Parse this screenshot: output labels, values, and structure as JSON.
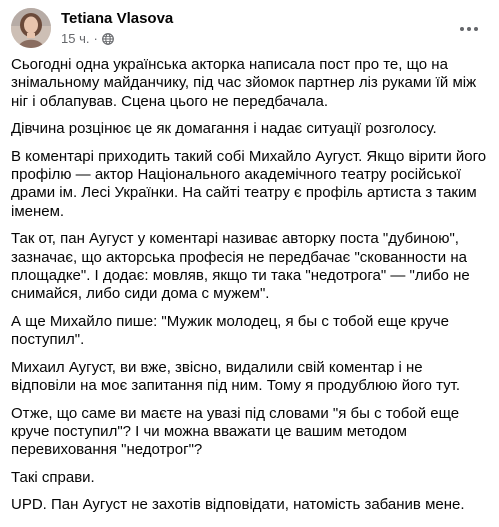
{
  "author": {
    "name": "Tetiana Vlasova",
    "time": "15 ч.",
    "separator": "·",
    "privacy_icon": "globe-icon",
    "avatar_icon": "profile-photo"
  },
  "menu": {
    "icon": "more-horizontal-icon"
  },
  "post": {
    "paragraphs": [
      "Сьогодні одна українська акторка написала пост про те, що на знімальному майданчику, під час зйомок партнер ліз руками їй між ніг і облапував. Сцена цього не передбачала.",
      "Дівчина розцінює це як домагання і надає ситуації розголосу.",
      "В коментарі приходить такий собі Михайло Аугуст. Якщо вірити його профілю — актор Національного академічного театру російської драми ім. Лесі Українки. На сайті театру є профіль артиста з таким іменем.",
      "Так от, пан Аугуст у коментарі називає авторку поста \"дубиною\", зазначає, що акторська професія не передбачає \"скованности на площадке\". І додає: мовляв, якщо ти така \"недотрога\" — \"либо не снимайся, либо сиди дома с мужем\".",
      "А ще Михайло пише: \"Мужик молодец, я бы с тобой еще круче поступил\".",
      "Михаил Аугуст, ви вже, звісно, видалили свій коментар і не відповіли на моє запитання під ним. Тому я продублюю його тут.",
      "Отже, що саме ви маєте на увазі під словами \"я бы с тобой еще круче поступил\"? І чи можна вважати це вашим методом перевиховання \"недотрог\"?",
      "Такі справи.",
      "UPD. Пан Аугуст не захотів відповідати, натомість забанив мене."
    ]
  },
  "colors": {
    "text": "#050505",
    "meta": "#65676b",
    "background": "#ffffff"
  }
}
